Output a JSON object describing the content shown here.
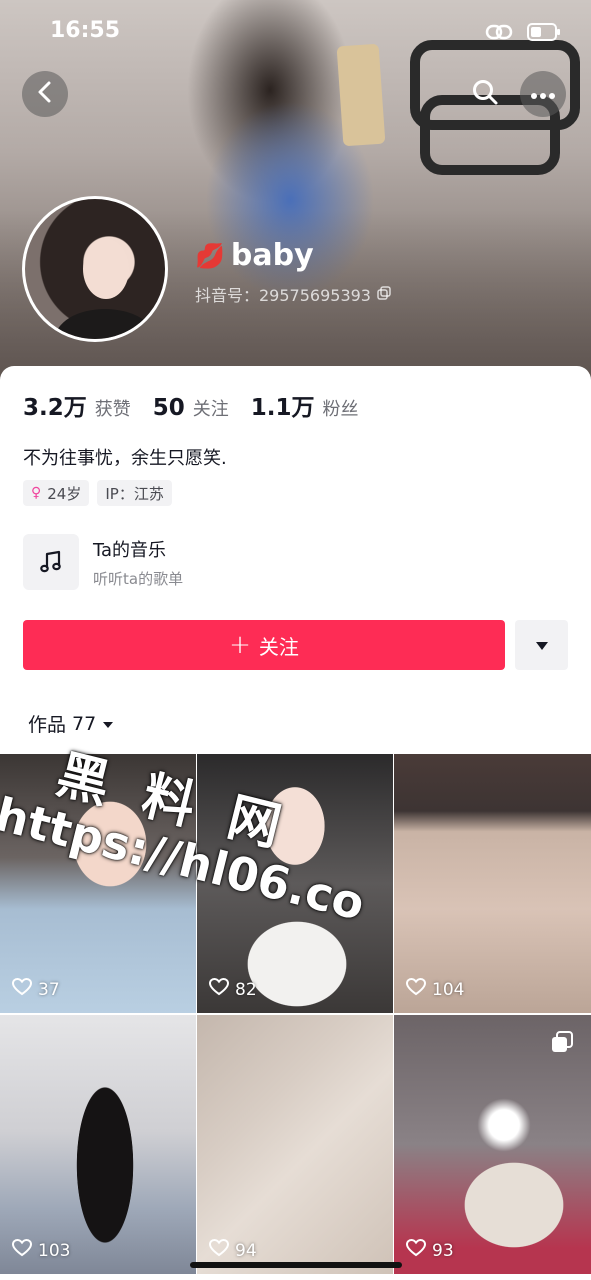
{
  "status_bar": {
    "time": "16:55"
  },
  "profile": {
    "name": "baby",
    "name_emoji": "💋",
    "douyin_id": "抖音号：29575695393"
  },
  "stats": [
    {
      "value": "3.2万",
      "label": "获赞"
    },
    {
      "value": "50",
      "label": "关注"
    },
    {
      "value": "1.1万",
      "label": "粉丝"
    }
  ],
  "bio": "不为往事忧，余生只愿笑.",
  "tags": {
    "gender_symbol": "♀",
    "age": "24岁",
    "ip": "IP：江苏"
  },
  "music": {
    "title": "Ta的音乐",
    "subtitle": "听听ta的歌单"
  },
  "actions": {
    "follow_plus": "+",
    "follow_label": "关注"
  },
  "tabs": {
    "works_label": "作品",
    "works_count": "77"
  },
  "videos": [
    {
      "likes": "37"
    },
    {
      "likes": "82"
    },
    {
      "likes": "104"
    },
    {
      "likes": "103"
    },
    {
      "likes": "94"
    },
    {
      "likes": "93"
    }
  ],
  "watermark": {
    "cn": "黑料网",
    "url": "https://hl06.co"
  },
  "colors": {
    "accent": "#fe2c55",
    "gender": "#f0459e"
  },
  "icons": [
    "back-icon",
    "search-icon",
    "more-icon",
    "link-icon",
    "battery-icon",
    "copy-icon",
    "music-note-icon",
    "caret-down-icon",
    "heart-icon",
    "multi-image-icon"
  ]
}
